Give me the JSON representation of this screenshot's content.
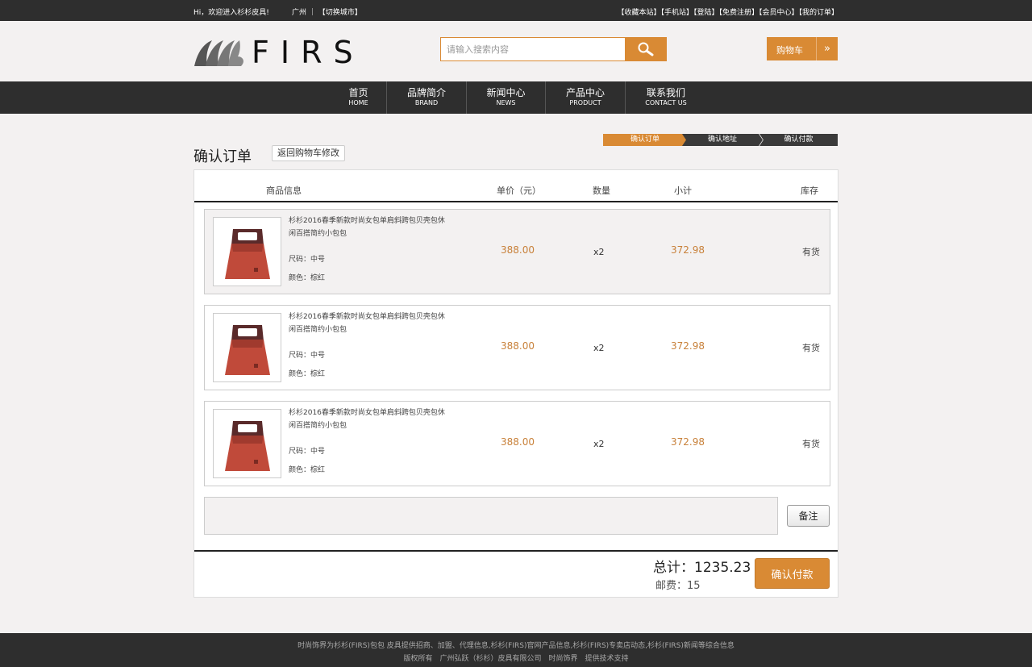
{
  "topbar": {
    "greeting": "Hi，欢迎进入杉杉皮具!",
    "city": "广州 ｜ 【切换城市】",
    "links": "【收藏本站】【手机站】【登陆】【免费注册】【会员中心】【我的订单】"
  },
  "logo": {
    "text": "FIRS"
  },
  "search": {
    "placeholder": "请输入搜索内容"
  },
  "cart": {
    "label": "购物车",
    "arrow": "»"
  },
  "nav": [
    {
      "cn": "首页",
      "en": "HOME"
    },
    {
      "cn": "品牌简介",
      "en": "BRAND"
    },
    {
      "cn": "新闻中心",
      "en": "NEWS"
    },
    {
      "cn": "产品中心",
      "en": "PRODUCT"
    },
    {
      "cn": "联系我们",
      "en": "CONTACT US"
    }
  ],
  "page": {
    "title": "确认订单",
    "back_label": "返回购物车修改"
  },
  "steps": [
    "确认订单",
    "确认地址",
    "确认付款"
  ],
  "table": {
    "headers": {
      "info": "商品信息",
      "price": "单价（元）",
      "qty": "数量",
      "subtotal": "小计",
      "stock": "库存"
    },
    "rows": [
      {
        "name": "杉杉2016春季新款时尚女包单肩斜跨包贝壳包休闲百搭简约小包包",
        "size": "尺码：中号",
        "color": "颜色：棕红",
        "price": "388.00",
        "qty": "x2",
        "subtotal": "372.98",
        "stock": "有货"
      },
      {
        "name": "杉杉2016春季新款时尚女包单肩斜跨包贝壳包休闲百搭简约小包包",
        "size": "尺码：中号",
        "color": "颜色：棕红",
        "price": "388.00",
        "qty": "x2",
        "subtotal": "372.98",
        "stock": "有货"
      },
      {
        "name": "杉杉2016春季新款时尚女包单肩斜跨包贝壳包休闲百搭简约小包包",
        "size": "尺码：中号",
        "color": "颜色：棕红",
        "price": "388.00",
        "qty": "x2",
        "subtotal": "372.98",
        "stock": "有货"
      }
    ]
  },
  "remark": {
    "label": "备注"
  },
  "summary": {
    "total": "总计：1235.23",
    "shipping": "邮费：15",
    "pay_label": "确认付款"
  },
  "footer": {
    "line1": "时尚饰界为杉杉(FIRS)包包 皮具提供招商、加盟、代理信息,杉杉(FIRS)官网产品信息,杉杉(FIRS)专卖店动态,杉杉(FIRS)新闻等综合信息",
    "line2": "版权所有　广州弘跃（杉杉）皮具有限公司　时尚饰界　提供技术支持"
  },
  "colors": {
    "accent": "#d98a34",
    "dark": "#2e2e2e",
    "price": "#c8813a"
  }
}
